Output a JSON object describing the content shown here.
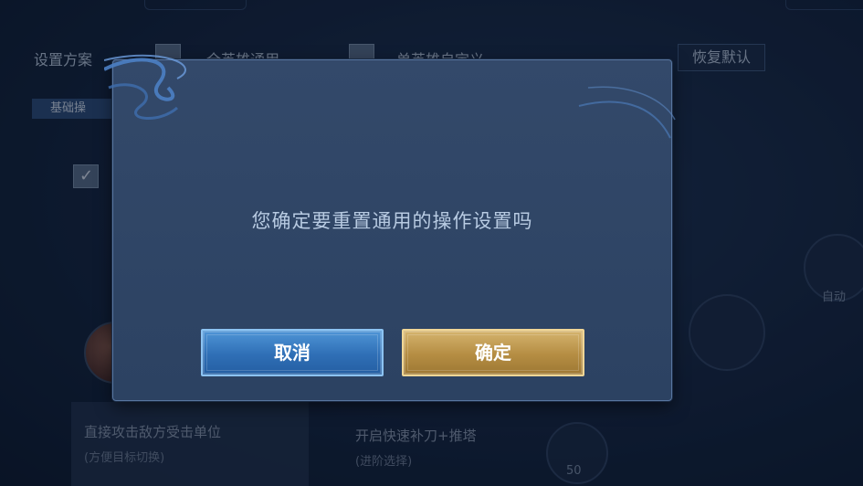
{
  "background": {
    "settings_label": "设置方案",
    "option_all_heroes": "全英雄通用",
    "option_single_hero": "单英雄自定义",
    "restore_default": "恢复默认",
    "basic_tab": "基础操",
    "attack_hint_line1": "直接攻击敌方受击单位",
    "attack_hint_line2": "(方便目标切换)",
    "quick_last_hit_line1": "开启快速补刀+推塔",
    "quick_last_hit_line2": "(进阶选择)",
    "right_label": "自动",
    "bottom_number": "50"
  },
  "dialog": {
    "message": "您确定要重置通用的操作设置吗",
    "cancel_label": "取消",
    "confirm_label": "确定"
  },
  "colors": {
    "cancel_button": "#2f6fb6",
    "confirm_button": "#b58d43",
    "dialog_bg": "#2f4565"
  }
}
